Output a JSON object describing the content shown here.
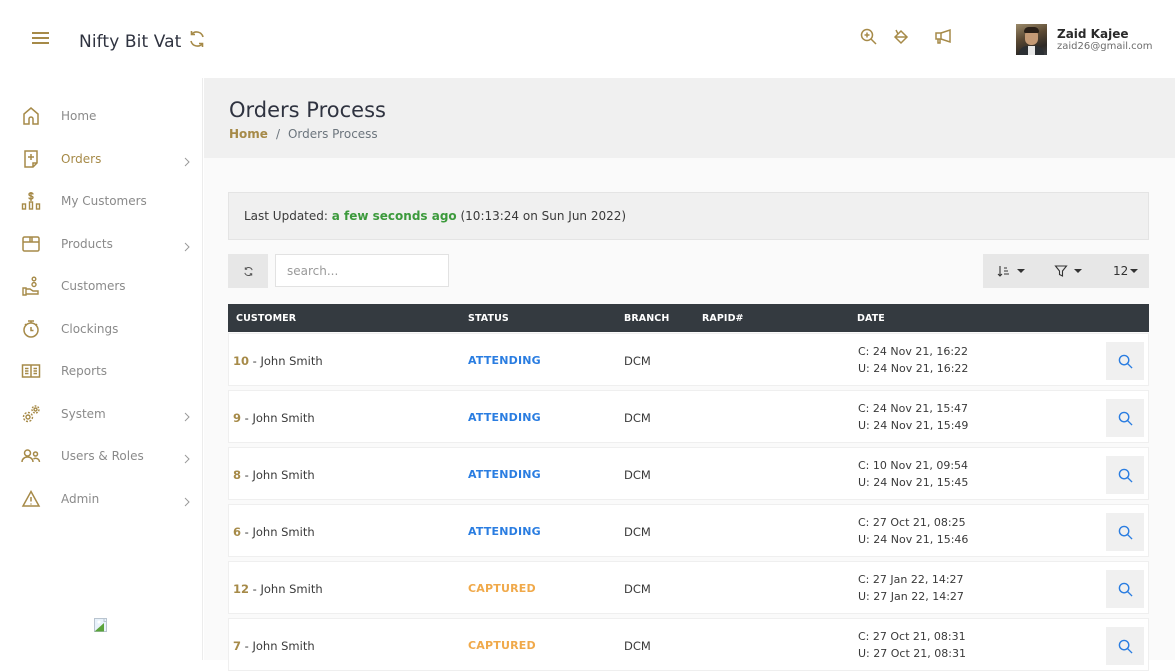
{
  "header": {
    "brand": "Nifty Bit Vat",
    "icons": [
      "search-plus-icon",
      "paint-bucket-icon",
      "megaphone-icon"
    ],
    "user": {
      "name": "Zaid Kajee",
      "email": "zaid26@gmail.com"
    }
  },
  "sidebar": {
    "items": [
      {
        "label": "Home",
        "icon": "home-icon",
        "active": false,
        "has_children": false
      },
      {
        "label": "Orders",
        "icon": "orders-icon",
        "active": true,
        "has_children": true
      },
      {
        "label": "My Customers",
        "icon": "dollar-bars-icon",
        "active": false,
        "has_children": false
      },
      {
        "label": "Products",
        "icon": "box-icon",
        "active": false,
        "has_children": true
      },
      {
        "label": "Customers",
        "icon": "hand-person-icon",
        "active": false,
        "has_children": false
      },
      {
        "label": "Clockings",
        "icon": "stopwatch-icon",
        "active": false,
        "has_children": false
      },
      {
        "label": "Reports",
        "icon": "book-icon",
        "active": false,
        "has_children": false
      },
      {
        "label": "System",
        "icon": "gears-icon",
        "active": false,
        "has_children": true
      },
      {
        "label": "Users & Roles",
        "icon": "users-icon",
        "active": false,
        "has_children": true
      },
      {
        "label": "Admin",
        "icon": "warning-icon",
        "active": false,
        "has_children": true
      }
    ]
  },
  "page": {
    "title": "Orders Process",
    "breadcrumb": {
      "home": "Home",
      "separator": "/",
      "current": "Orders Process"
    }
  },
  "last_updated": {
    "label": "Last Updated: ",
    "relative": "a few seconds ago",
    "absolute": " (10:13:24 on Sun Jun 2022)"
  },
  "toolbar": {
    "search_placeholder": "search...",
    "search_value": "",
    "page_size": "12"
  },
  "table": {
    "columns": [
      "CUSTOMER",
      "STATUS",
      "BRANCH",
      "RAPID#",
      "DATE"
    ],
    "status_colors": {
      "ATTENDING": "#2a7de1",
      "CAPTURED": "#f0a94a"
    },
    "rows": [
      {
        "id": "10",
        "name": " - John Smith",
        "status": "ATTENDING",
        "branch": "DCM",
        "rapid": "",
        "created": "C: 24 Nov 21, 16:22",
        "updated": "U: 24 Nov 21, 16:22"
      },
      {
        "id": "9",
        "name": " - John Smith",
        "status": "ATTENDING",
        "branch": "DCM",
        "rapid": "",
        "created": "C: 24 Nov 21, 15:47",
        "updated": "U: 24 Nov 21, 15:49"
      },
      {
        "id": "8",
        "name": " - John Smith",
        "status": "ATTENDING",
        "branch": "DCM",
        "rapid": "",
        "created": "C: 10 Nov 21, 09:54",
        "updated": "U: 24 Nov 21, 15:45"
      },
      {
        "id": "6",
        "name": " - John Smith",
        "status": "ATTENDING",
        "branch": "DCM",
        "rapid": "",
        "created": "C: 27 Oct 21, 08:25",
        "updated": "U: 24 Nov 21, 15:46"
      },
      {
        "id": "12",
        "name": " - John Smith",
        "status": "CAPTURED",
        "branch": "DCM",
        "rapid": "",
        "created": "C: 27 Jan 22, 14:27",
        "updated": "U: 27 Jan 22, 14:27"
      },
      {
        "id": "7",
        "name": " - John Smith",
        "status": "CAPTURED",
        "branch": "DCM",
        "rapid": "",
        "created": "C: 27 Oct 21, 08:31",
        "updated": "U: 27 Oct 21, 08:31"
      }
    ]
  },
  "colors": {
    "accent": "#a68a48",
    "header_dark": "#343a40",
    "success": "#3c9a3c",
    "link_blue": "#2a7de1"
  }
}
